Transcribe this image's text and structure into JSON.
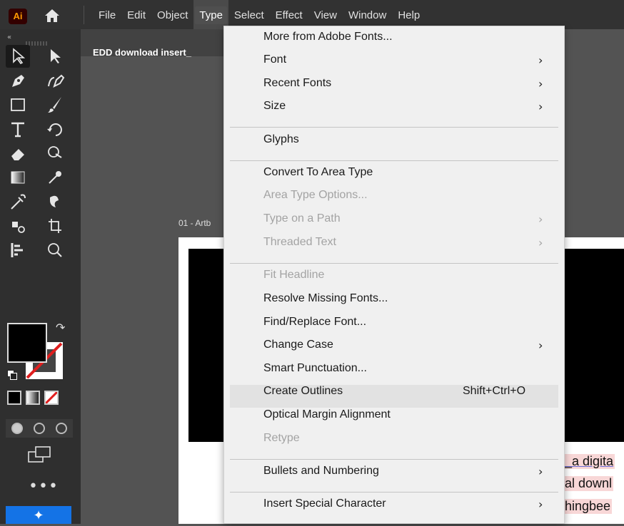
{
  "app": {
    "logo_text": "Ai",
    "brand_color": "#ff9a00"
  },
  "menubar": {
    "items": [
      {
        "label": "File"
      },
      {
        "label": "Edit"
      },
      {
        "label": "Object"
      },
      {
        "label": "Type"
      },
      {
        "label": "Select"
      },
      {
        "label": "Effect"
      },
      {
        "label": "View"
      },
      {
        "label": "Window"
      },
      {
        "label": "Help"
      }
    ],
    "active": "Type"
  },
  "document": {
    "tab_title": "EDD download insert_",
    "artboard_label": "01 - Artb",
    "lines": [
      "_a digita",
      "al downl",
      " hingbee"
    ]
  },
  "toolbar": {
    "collapse_icon": "«",
    "more_label": "•••",
    "swap_icon": "↷"
  },
  "type_menu": {
    "items": [
      {
        "label": "More from Adobe Fonts...",
        "enabled": true
      },
      {
        "label": "Font",
        "enabled": true,
        "submenu": true
      },
      {
        "label": "Recent Fonts",
        "enabled": true,
        "submenu": true
      },
      {
        "label": "Size",
        "enabled": true,
        "submenu": true
      },
      {
        "label": "Glyphs",
        "enabled": true
      },
      {
        "label": "Convert To Area Type",
        "enabled": true
      },
      {
        "label": "Area Type Options...",
        "enabled": false
      },
      {
        "label": "Type on a Path",
        "enabled": false,
        "submenu": true
      },
      {
        "label": "Threaded Text",
        "enabled": false,
        "submenu": true
      },
      {
        "label": "Fit Headline",
        "enabled": false
      },
      {
        "label": "Resolve Missing Fonts...",
        "enabled": true
      },
      {
        "label": "Find/Replace Font...",
        "enabled": true
      },
      {
        "label": "Change Case",
        "enabled": true,
        "submenu": true
      },
      {
        "label": "Smart Punctuation...",
        "enabled": true
      },
      {
        "label": "Create Outlines",
        "enabled": true,
        "shortcut": "Shift+Ctrl+O",
        "highlighted": true
      },
      {
        "label": "Optical Margin Alignment",
        "enabled": true
      },
      {
        "label": "Retype",
        "enabled": false
      },
      {
        "label": "Bullets and Numbering",
        "enabled": true,
        "submenu": true
      },
      {
        "label": "Insert Special Character",
        "enabled": true,
        "submenu": true
      }
    ],
    "submenu_arrow": "›"
  }
}
